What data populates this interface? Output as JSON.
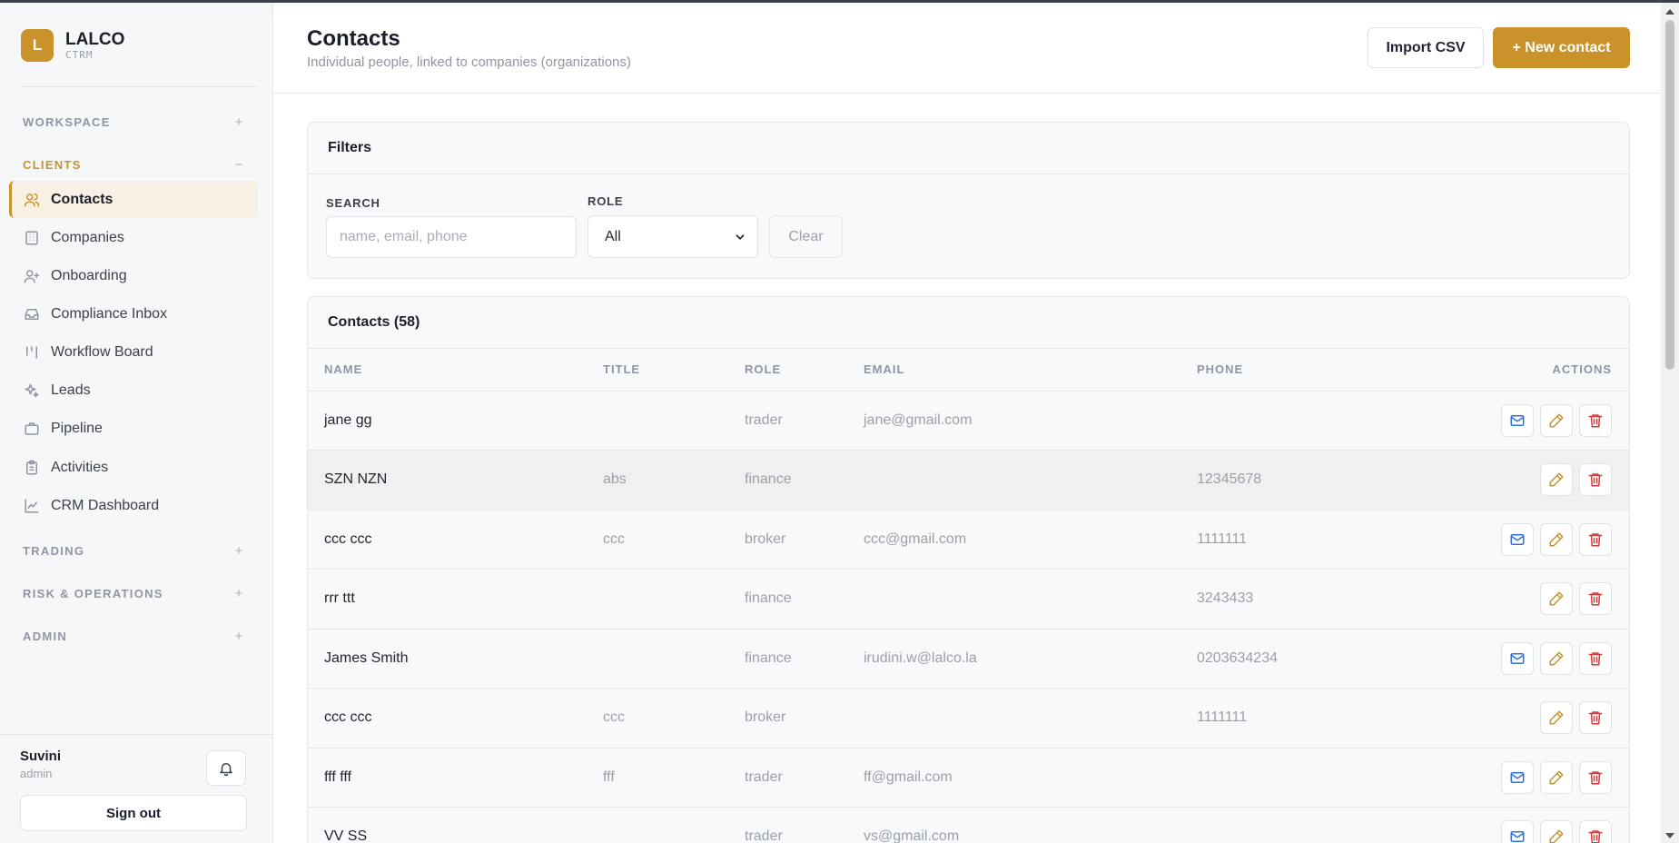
{
  "brand": {
    "logo_letter": "L",
    "name": "LALCO",
    "sub": "CTRM"
  },
  "sidebar": {
    "sections": {
      "workspace": {
        "label": "WORKSPACE",
        "toggle": "+"
      },
      "clients": {
        "label": "CLIENTS",
        "toggle": "−"
      },
      "trading": {
        "label": "TRADING",
        "toggle": "+"
      },
      "risk": {
        "label": "RISK & OPERATIONS",
        "toggle": "+"
      },
      "admin": {
        "label": "ADMIN",
        "toggle": "+"
      }
    },
    "items": [
      {
        "label": "Contacts",
        "icon": "users-icon",
        "active": true
      },
      {
        "label": "Companies",
        "icon": "building-icon"
      },
      {
        "label": "Onboarding",
        "icon": "user-plus-icon"
      },
      {
        "label": "Compliance Inbox",
        "icon": "inbox-icon"
      },
      {
        "label": "Workflow Board",
        "icon": "kanban-icon"
      },
      {
        "label": "Leads",
        "icon": "sparkles-icon"
      },
      {
        "label": "Pipeline",
        "icon": "briefcase-icon"
      },
      {
        "label": "Activities",
        "icon": "clipboard-icon"
      },
      {
        "label": "CRM Dashboard",
        "icon": "line-chart-icon"
      }
    ]
  },
  "user": {
    "name": "Suvini",
    "role": "admin",
    "signout_label": "Sign out"
  },
  "header": {
    "title": "Contacts",
    "subtitle": "Individual people, linked to companies (organizations)",
    "import_label": "Import CSV",
    "new_label": "+ New contact"
  },
  "filters": {
    "title": "Filters",
    "search_label": "SEARCH",
    "search_placeholder": "name, email, phone",
    "search_value": "",
    "role_label": "ROLE",
    "role_value": "All",
    "clear_label": "Clear"
  },
  "table": {
    "title": "Contacts (58)",
    "columns": [
      "NAME",
      "TITLE",
      "ROLE",
      "EMAIL",
      "PHONE",
      "ACTIONS"
    ],
    "rows": [
      {
        "name": "jane gg",
        "title": "",
        "role": "trader",
        "email": "jane@gmail.com",
        "phone": ""
      },
      {
        "name": "SZN NZN",
        "title": "abs",
        "role": "finance",
        "email": "",
        "phone": "12345678"
      },
      {
        "name": "ccc ccc",
        "title": "ccc",
        "role": "broker",
        "email": "ccc@gmail.com",
        "phone": "1111111"
      },
      {
        "name": "rrr ttt",
        "title": "",
        "role": "finance",
        "email": "",
        "phone": "3243433"
      },
      {
        "name": "James Smith",
        "title": "",
        "role": "finance",
        "email": "irudini.w@lalco.la",
        "phone": "0203634234"
      },
      {
        "name": "ccc ccc",
        "title": "ccc",
        "role": "broker",
        "email": "",
        "phone": "1111111"
      },
      {
        "name": "fff fff",
        "title": "fff",
        "role": "trader",
        "email": "ff@gmail.com",
        "phone": ""
      },
      {
        "name": "VV SS",
        "title": "",
        "role": "trader",
        "email": "vs@gmail.com",
        "phone": ""
      }
    ]
  },
  "colors": {
    "accent": "#c9922b",
    "mail": "#2f6fdb",
    "edit": "#c9922b",
    "delete": "#d33a3a"
  }
}
